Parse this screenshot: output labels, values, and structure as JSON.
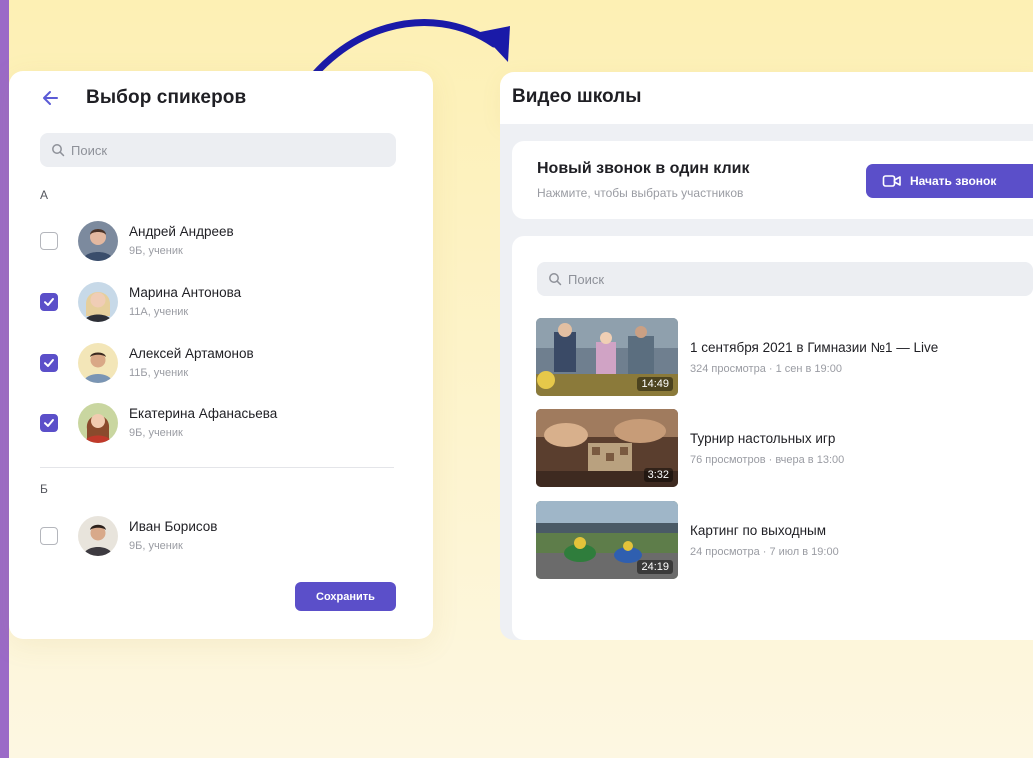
{
  "left_panel": {
    "title": "Выбор спикеров",
    "search_placeholder": "Поиск",
    "groups": [
      {
        "letter": "А",
        "people": [
          {
            "name": "Андрей Андреев",
            "subtitle": "9Б, ученик",
            "checked": false
          },
          {
            "name": "Марина Антонова",
            "subtitle": "11А, ученик",
            "checked": true
          },
          {
            "name": "Алексей Артамонов",
            "subtitle": "11Б, ученик",
            "checked": true
          },
          {
            "name": "Екатерина Афанасьева",
            "subtitle": "9Б, ученик",
            "checked": true
          }
        ]
      },
      {
        "letter": "Б",
        "people": [
          {
            "name": "Иван Борисов",
            "subtitle": "9Б, ученик",
            "checked": false
          }
        ]
      }
    ],
    "save_label": "Сохранить"
  },
  "right_panel": {
    "title": "Видео школы",
    "call": {
      "title": "Новый звонок в один клик",
      "subtitle": "Нажмите, чтобы выбрать участников",
      "button_label": "Начать звонок"
    },
    "search_placeholder": "Поиск",
    "videos": [
      {
        "title": "1 сентября 2021 в Гимназии №1 — Live",
        "meta": "324 просмотра · 1 сен в 19:00",
        "duration": "14:49"
      },
      {
        "title": "Турнир настольных игр",
        "meta": "76 просмотров · вчера в 13:00",
        "duration": "3:32"
      },
      {
        "title": "Картинг по выходным",
        "meta": "24 просмотра · 7 июл в 19:00",
        "duration": "24:19"
      }
    ]
  },
  "colors": {
    "accent": "#5b4fc9",
    "background": "#fdf3c8",
    "arrow": "#1a1aa8",
    "left_stripe": "#9b6ac7"
  },
  "icons": {
    "back": "arrow-left-icon",
    "search": "search-icon",
    "checkbox": "check-icon",
    "call": "video-camera-icon",
    "arrow": "curved-arrow-icon"
  }
}
